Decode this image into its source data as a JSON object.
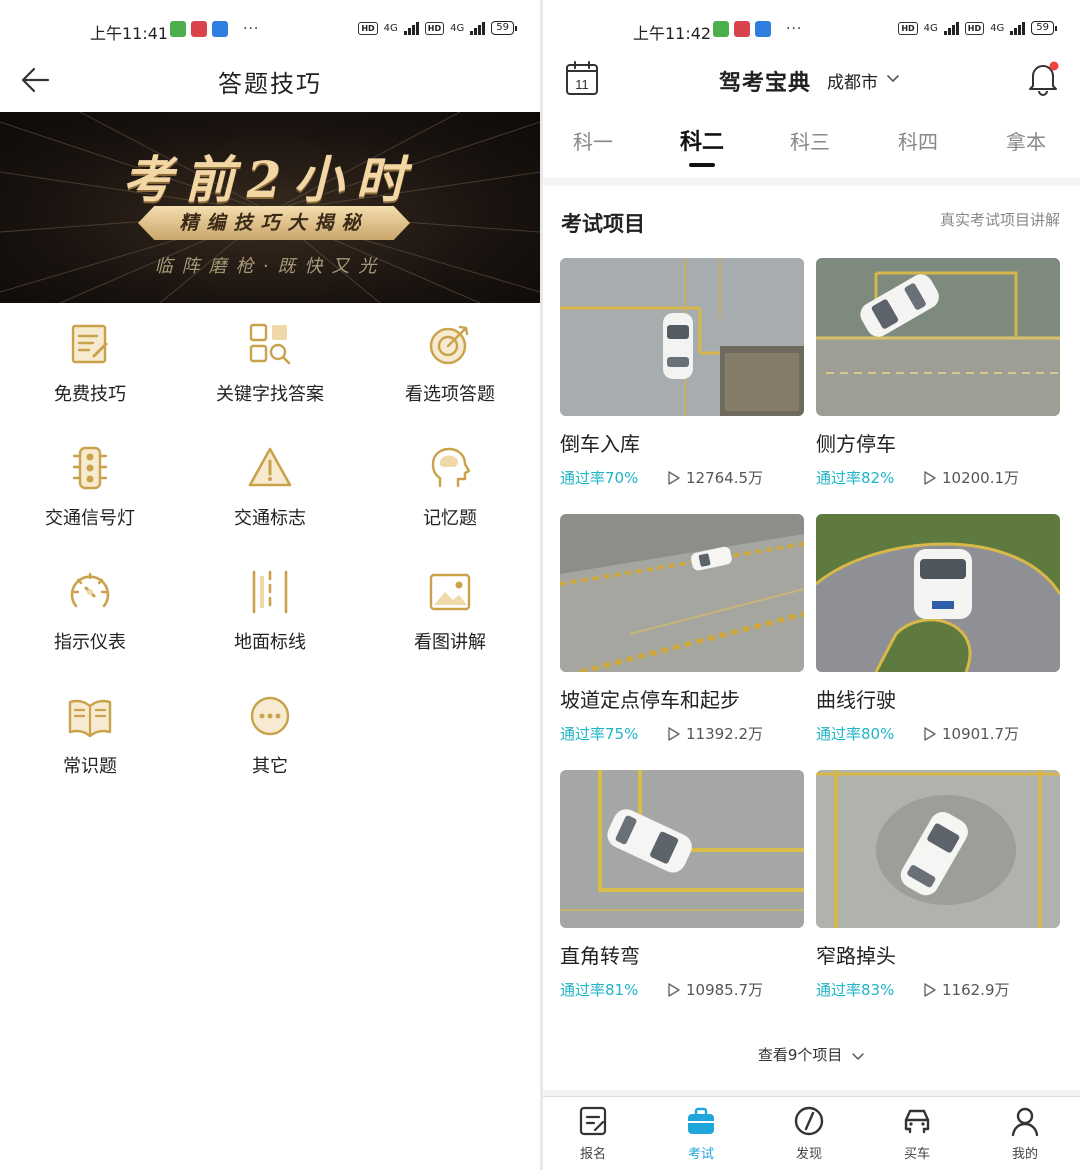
{
  "left_screen": {
    "status": {
      "time": "上午11:41",
      "battery": "59",
      "net1": "4G",
      "net2": "4G",
      "hd": "HD",
      "dots": "···"
    },
    "header": {
      "title": "答题技巧"
    },
    "banner": {
      "title": "考前2小时",
      "tag": "精编技巧大揭秘",
      "subtitle": "临阵磨枪·既快又光"
    },
    "grid": [
      {
        "label": "免费技巧",
        "icon": "notebook-pen-icon"
      },
      {
        "label": "关键字找答案",
        "icon": "keyword-search-icon"
      },
      {
        "label": "看选项答题",
        "icon": "target-icon"
      },
      {
        "label": "交通信号灯",
        "icon": "traffic-light-icon"
      },
      {
        "label": "交通标志",
        "icon": "warning-sign-icon"
      },
      {
        "label": "记忆题",
        "icon": "brain-head-icon"
      },
      {
        "label": "指示仪表",
        "icon": "gauge-icon"
      },
      {
        "label": "地面标线",
        "icon": "road-lines-icon"
      },
      {
        "label": "看图讲解",
        "icon": "image-icon"
      },
      {
        "label": "常识题",
        "icon": "open-book-icon"
      },
      {
        "label": "其它",
        "icon": "more-circle-icon"
      }
    ],
    "accent_color": "#c9a24b"
  },
  "right_screen": {
    "status": {
      "time": "上午11:42",
      "battery": "59",
      "net1": "4G",
      "net2": "4G",
      "hd": "HD",
      "dots": "···"
    },
    "header": {
      "calendar_day": "11",
      "title": "驾考宝典",
      "city": "成都市"
    },
    "tabs": [
      {
        "label": "科一",
        "active": false
      },
      {
        "label": "科二",
        "active": true
      },
      {
        "label": "科三",
        "active": false
      },
      {
        "label": "科四",
        "active": false
      },
      {
        "label": "拿本",
        "active": false
      }
    ],
    "section": {
      "title": "考试项目",
      "link": "真实考试项目讲解"
    },
    "items": [
      {
        "name": "倒车入库",
        "rate": "通过率70%",
        "views": "12764.5万"
      },
      {
        "name": "侧方停车",
        "rate": "通过率82%",
        "views": "10200.1万"
      },
      {
        "name": "坡道定点停车和起步",
        "rate": "通过率75%",
        "views": "11392.2万"
      },
      {
        "name": "曲线行驶",
        "rate": "通过率80%",
        "views": "10901.7万"
      },
      {
        "name": "直角转弯",
        "rate": "通过率81%",
        "views": "10985.7万"
      },
      {
        "name": "窄路掉头",
        "rate": "通过率83%",
        "views": "1162.9万"
      }
    ],
    "more": {
      "label": "查看9个项目"
    },
    "tabbar": [
      {
        "label": "报名",
        "icon": "signup-icon",
        "active": false
      },
      {
        "label": "考试",
        "icon": "exam-bag-icon",
        "active": true
      },
      {
        "label": "发现",
        "icon": "compass-icon",
        "active": false
      },
      {
        "label": "买车",
        "icon": "car-front-icon",
        "active": false
      },
      {
        "label": "我的",
        "icon": "user-icon",
        "active": false
      }
    ],
    "colors": {
      "rate": "#1fb5c9",
      "active_tab": "#1fa7dc"
    }
  }
}
